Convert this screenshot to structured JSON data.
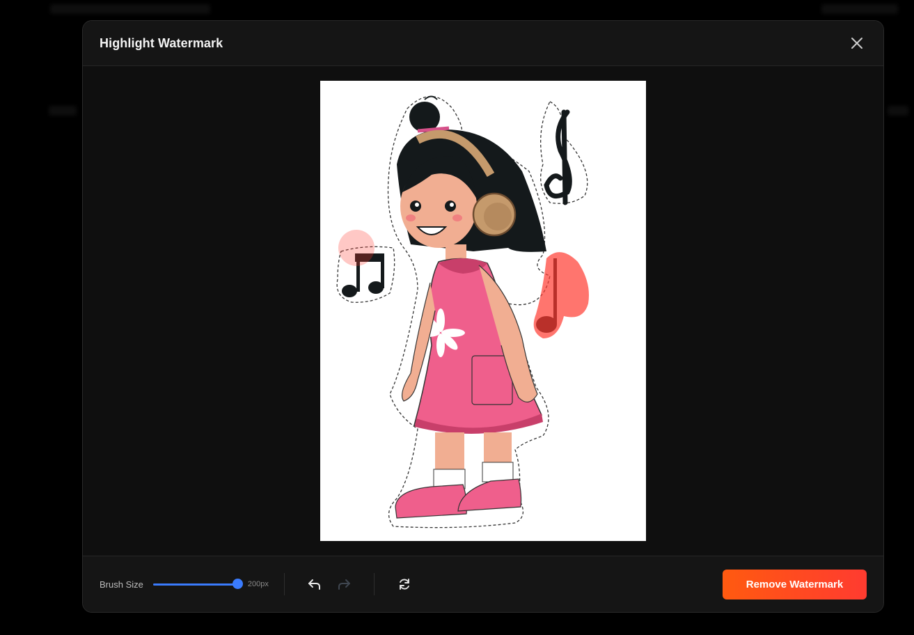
{
  "modal": {
    "title": "Highlight Watermark",
    "close_icon": "close-icon"
  },
  "toolbar": {
    "brush_label": "Brush Size",
    "brush_value_text": "200px",
    "brush_level_fraction": 1.0,
    "undo_icon": "undo-icon",
    "redo_icon": "redo-icon",
    "reset_icon": "refresh-icon",
    "remove_label": "Remove Watermark"
  },
  "colors": {
    "accent_blue": "#3a7bfd",
    "remove_button_start": "#ff5a10",
    "remove_button_end": "#ff3b30",
    "highlight_mask": "#ff3b30"
  }
}
